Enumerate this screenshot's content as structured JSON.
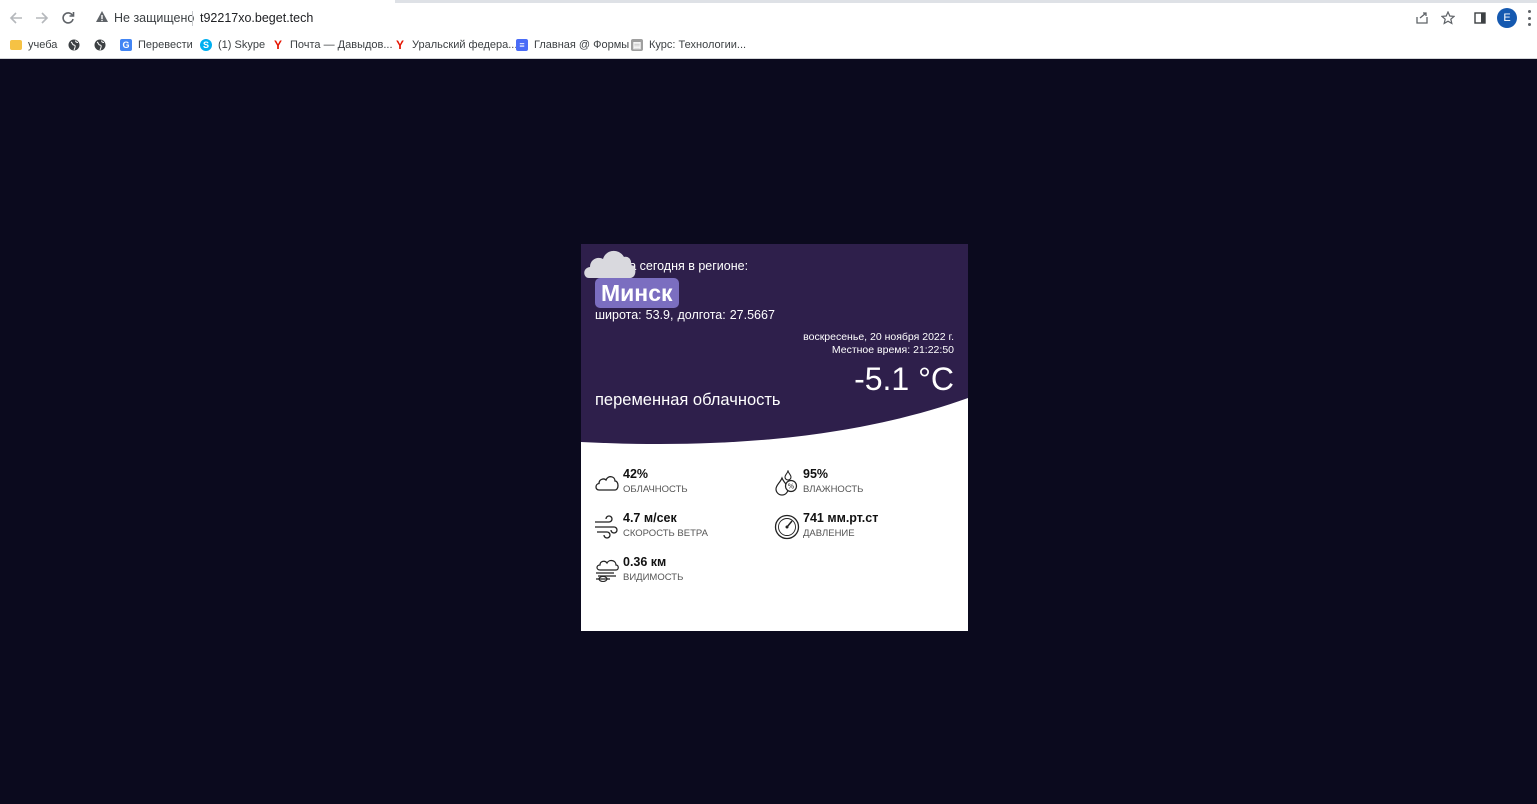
{
  "browser": {
    "security_status": "Не защищено",
    "url": "t92217xo.beget.tech",
    "avatar_letter": "E",
    "bookmarks": [
      {
        "label": "учеба",
        "icon": "folder-icon"
      },
      {
        "label": "",
        "icon": "globe-icon"
      },
      {
        "label": "",
        "icon": "globe-icon"
      },
      {
        "label": "Перевести",
        "icon": "translate-icon"
      },
      {
        "label": "(1) Skype",
        "icon": "skype-icon"
      },
      {
        "label": "Почта — Давыдов...",
        "icon": "yandex-icon"
      },
      {
        "label": "Уральский федера...",
        "icon": "yandex-icon"
      },
      {
        "label": "Главная @ Формы",
        "icon": "forms-icon"
      },
      {
        "label": "Курс: Технологии...",
        "icon": "course-icon"
      }
    ]
  },
  "weather": {
    "region_title": "Погода сегодня в регионе:",
    "city": "Минск",
    "coords": {
      "lat_label": "широта:",
      "lat": "53.9,",
      "lon_label": "долгота:",
      "lon": "27.5667"
    },
    "date": "воскресенье, 20 ноября 2022 г.",
    "time_label": "Местное время:",
    "time": "21:22:50",
    "temperature": "-5.1 °C",
    "condition": "переменная облачность",
    "condition_icon": "cloud-icon",
    "stats": {
      "cloudiness": {
        "value": "42%",
        "label": "ОБЛАЧНОСТЬ",
        "icon": "cloud-outline-icon"
      },
      "humidity": {
        "value": "95%",
        "label": "ВЛАЖНОСТЬ",
        "icon": "humidity-icon"
      },
      "wind": {
        "value": "4.7 м/сек",
        "label": "СКОРОСТЬ ВЕТРА",
        "icon": "wind-icon"
      },
      "pressure": {
        "value": "741 мм.рт.ст",
        "label": "ДАВЛЕНИЕ",
        "icon": "gauge-icon"
      },
      "visibility": {
        "value": "0.36 км",
        "label": "ВИДИМОСТЬ",
        "icon": "fog-icon"
      }
    }
  },
  "colors": {
    "page_background": "#0b0a1e",
    "card_header": "#2e1f4b",
    "city_badge": "#7b6ec0"
  }
}
